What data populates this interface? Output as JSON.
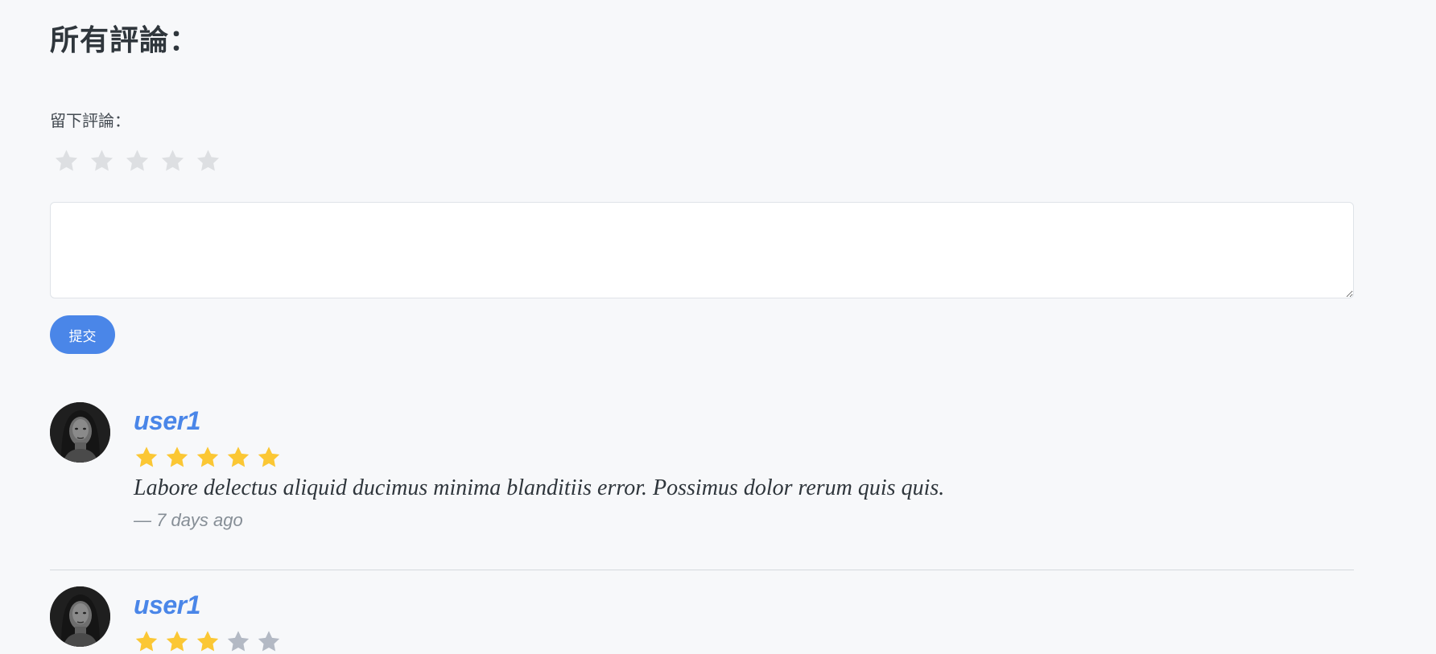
{
  "page": {
    "title": "所有評論：",
    "leave_review_label": "留下評論：",
    "comment_input": {
      "value": "",
      "placeholder": ""
    },
    "submit_label": "提交",
    "rating_input": {
      "selected": 0,
      "max": 5
    }
  },
  "colors": {
    "background": "#f7f8fa",
    "accent": "#4a86e8",
    "star_filled": "#fbc734",
    "star_empty_review": "#b3b9c4",
    "star_empty_input": "#dddfe2"
  },
  "reviews": [
    {
      "username": "user1",
      "rating": 5,
      "text": "Labore delectus aliquid ducimus minima blanditiis error. Possimus dolor rerum quis quis.",
      "time": "— 7 days ago",
      "avatar": "user-avatar-photo"
    },
    {
      "username": "user1",
      "rating": 3,
      "text": "",
      "time": "",
      "avatar": "user-avatar-photo"
    }
  ]
}
